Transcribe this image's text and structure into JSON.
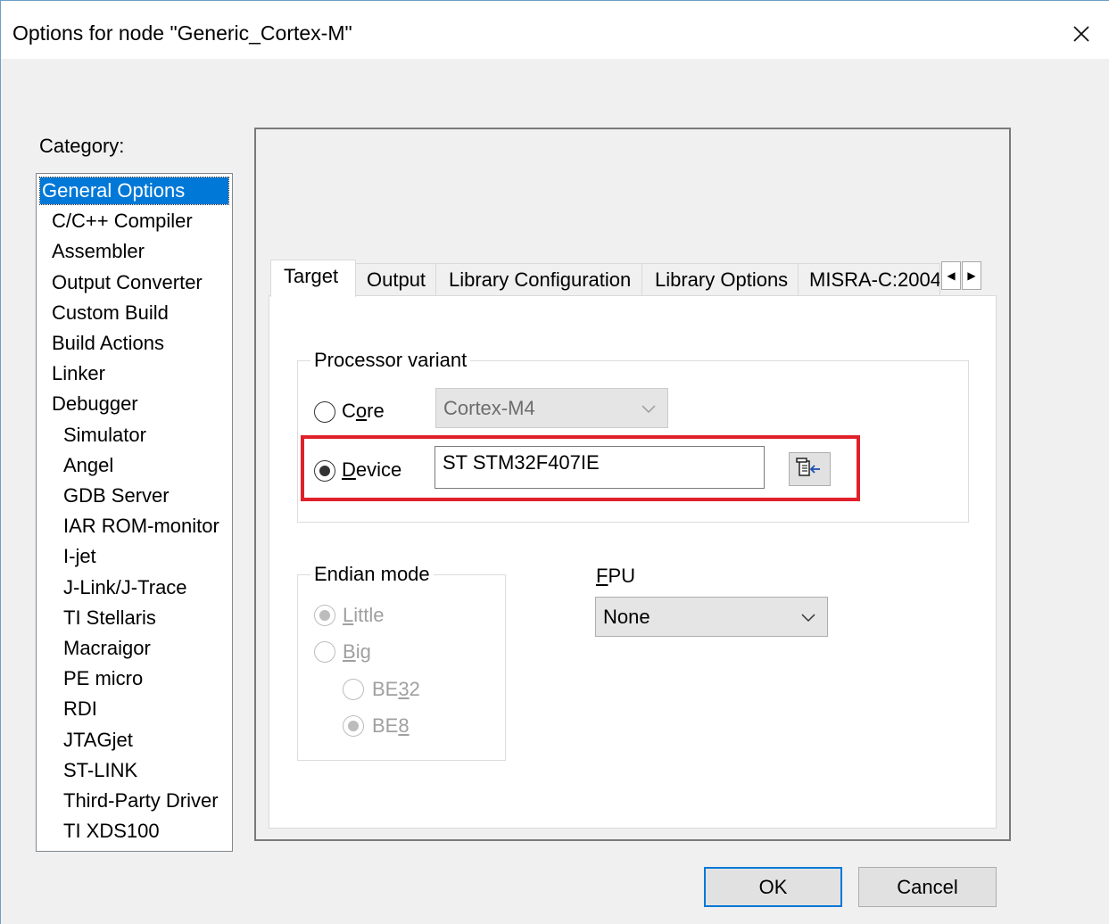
{
  "window": {
    "title": "Options for node \"Generic_Cortex-M\""
  },
  "category": {
    "label": "Category:",
    "items": [
      {
        "label": "General Options",
        "selected": true,
        "indent": 0
      },
      {
        "label": "C/C++ Compiler",
        "indent": 1
      },
      {
        "label": "Assembler",
        "indent": 1
      },
      {
        "label": "Output Converter",
        "indent": 1
      },
      {
        "label": "Custom Build",
        "indent": 1
      },
      {
        "label": "Build Actions",
        "indent": 1
      },
      {
        "label": "Linker",
        "indent": 1
      },
      {
        "label": "Debugger",
        "indent": 1
      },
      {
        "label": "Simulator",
        "indent": 2
      },
      {
        "label": "Angel",
        "indent": 2
      },
      {
        "label": "GDB Server",
        "indent": 2
      },
      {
        "label": "IAR ROM-monitor",
        "indent": 2
      },
      {
        "label": "I-jet",
        "indent": 2
      },
      {
        "label": "J-Link/J-Trace",
        "indent": 2
      },
      {
        "label": "TI Stellaris",
        "indent": 2
      },
      {
        "label": "Macraigor",
        "indent": 2
      },
      {
        "label": "PE micro",
        "indent": 2
      },
      {
        "label": "RDI",
        "indent": 2
      },
      {
        "label": "JTAGjet",
        "indent": 2
      },
      {
        "label": "ST-LINK",
        "indent": 2
      },
      {
        "label": "Third-Party Driver",
        "indent": 2
      },
      {
        "label": "TI XDS100",
        "indent": 2
      }
    ]
  },
  "tabs": [
    {
      "label": "Target",
      "active": true
    },
    {
      "label": "Output"
    },
    {
      "label": "Library Configuration"
    },
    {
      "label": "Library Options"
    },
    {
      "label": "MISRA-C:2004"
    }
  ],
  "processor_variant": {
    "legend": "Processor variant",
    "core": {
      "label_pre": "C",
      "label_ul": "o",
      "label_post": "re",
      "checked": false,
      "select_value": "Cortex-M4"
    },
    "device": {
      "label_pre": "",
      "label_ul": "D",
      "label_post": "evice",
      "checked": true,
      "value": "ST STM32F407IE"
    }
  },
  "endian_mode": {
    "legend": "Endian mode",
    "little": {
      "label_ul": "L",
      "label_post": "ittle",
      "checked": true
    },
    "big": {
      "label_ul": "B",
      "label_post": "ig",
      "checked": false
    },
    "be32": {
      "label_pre": "BE",
      "label_ul": "3",
      "label_post": "2",
      "checked": false
    },
    "be8": {
      "label_pre": "BE",
      "label_ul": "8",
      "label_post": "",
      "checked": true
    }
  },
  "fpu": {
    "label_ul": "F",
    "label_post": "PU",
    "value": "None"
  },
  "buttons": {
    "ok": "OK",
    "cancel": "Cancel"
  },
  "colors": {
    "highlight_border": "#e0202a",
    "selection": "#0078d7"
  },
  "icons": {
    "close": "close-icon",
    "device_select": "device-select-icon",
    "tab_scroll_left": "scroll-left-icon",
    "tab_scroll_right": "scroll-right-icon"
  }
}
